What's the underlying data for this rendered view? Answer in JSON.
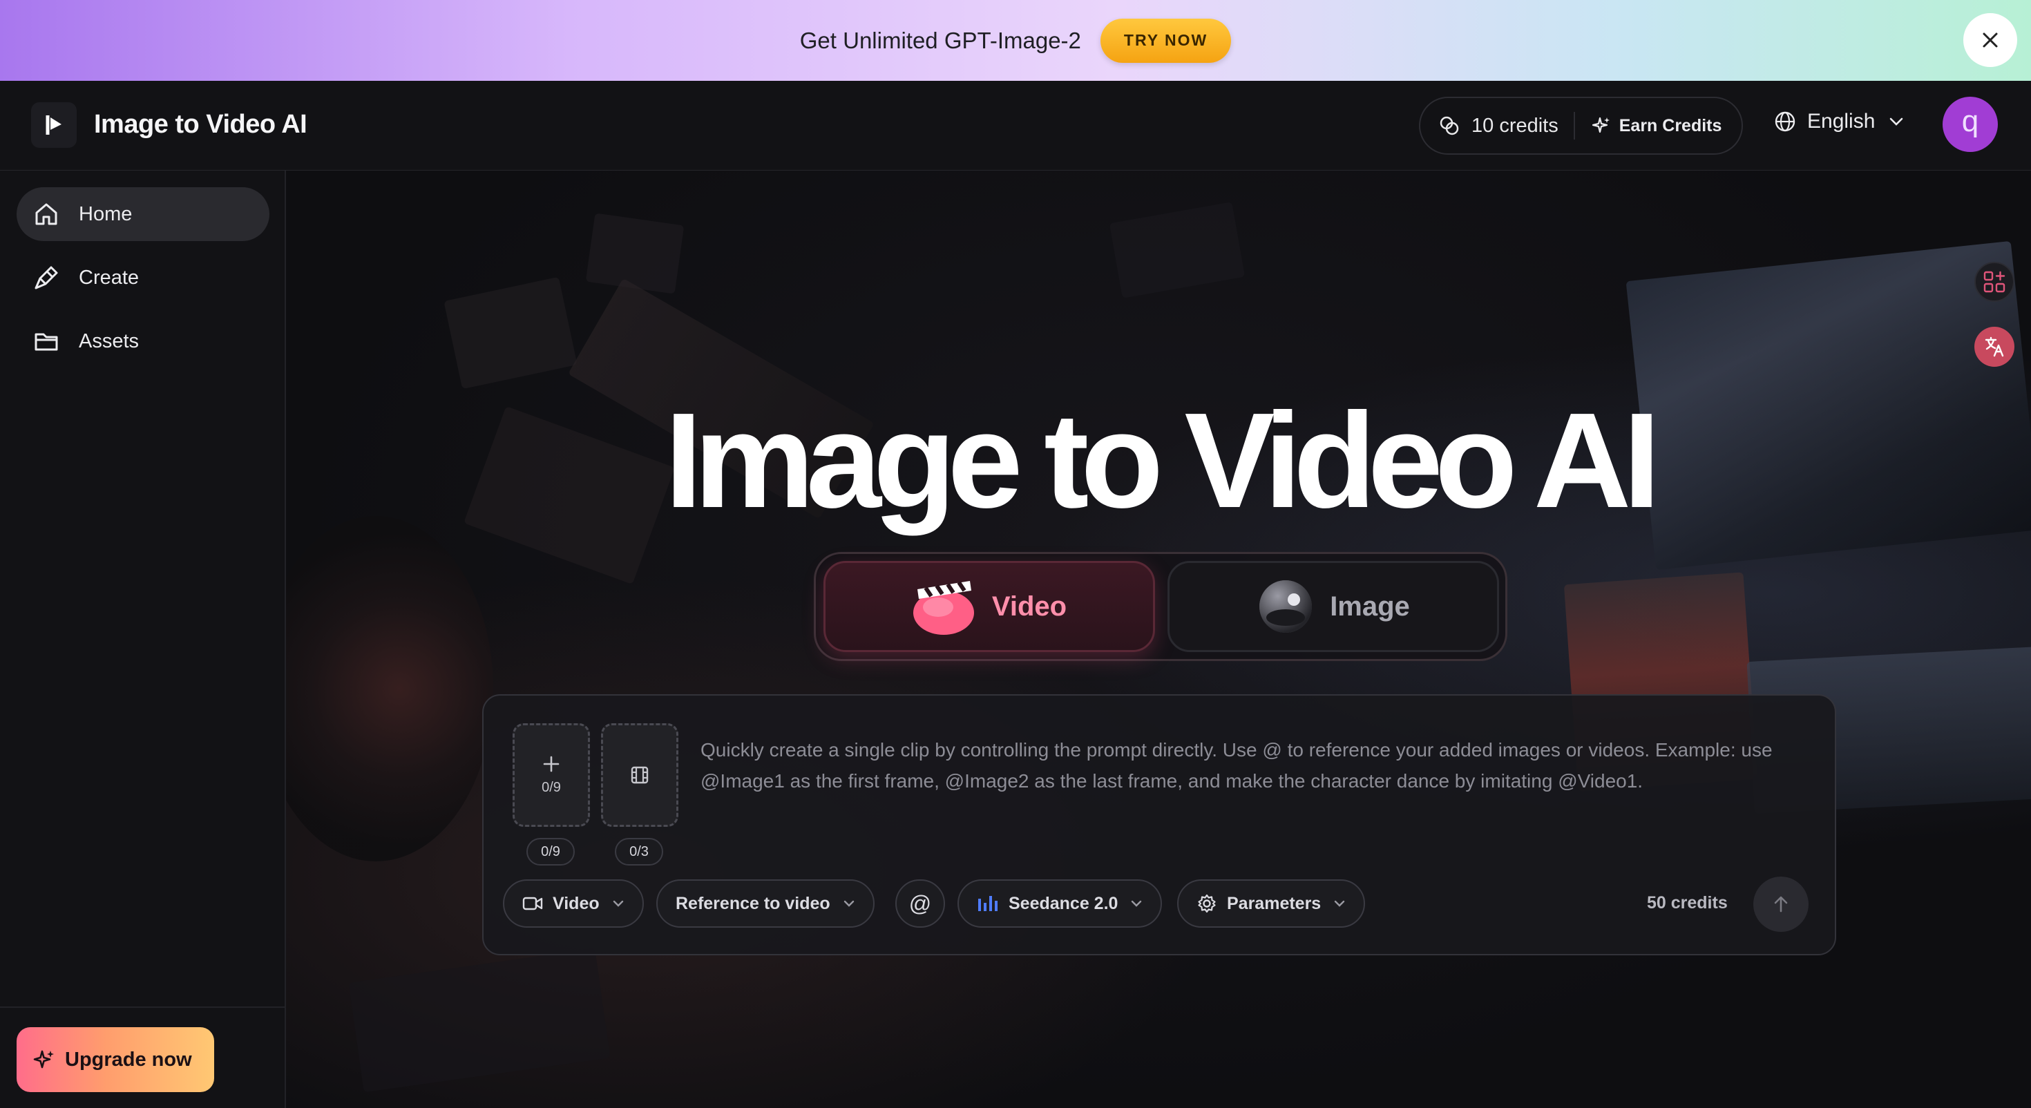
{
  "promo": {
    "text": "Get Unlimited GPT-Image-2",
    "button_label": "TRY NOW",
    "close_icon": "close-icon"
  },
  "header": {
    "app_title": "Image to Video AI",
    "credits_label": "10 credits",
    "earn_label": "Earn Credits",
    "language": "English",
    "avatar_initial": "q"
  },
  "sidebar": {
    "items": [
      {
        "label": "Home",
        "icon": "home-icon",
        "active": true
      },
      {
        "label": "Create",
        "icon": "brush-icon",
        "active": false
      },
      {
        "label": "Assets",
        "icon": "folder-icon",
        "active": false
      }
    ],
    "upgrade_label": "Upgrade now"
  },
  "hero": {
    "title": "Image to Video AI",
    "modes": [
      {
        "label": "Video",
        "selected": true
      },
      {
        "label": "Image",
        "selected": false
      }
    ]
  },
  "composer": {
    "image_slot_count": "0/9",
    "image_badge": "0/9",
    "video_badge": "0/3",
    "prompt_placeholder": "Quickly create a single clip by controlling the prompt directly. Use @ to reference your added images or videos. Example: use @Image1 as the first frame, @Image2 as the last frame, and make the character dance by imitating @Video1.",
    "type_label": "Video",
    "mode_label": "Reference to video",
    "at_label": "@",
    "model_label": "Seedance 2.0",
    "params_label": "Parameters",
    "cost_label": "50 credits"
  },
  "colors": {
    "accent_pink": "#ff8fab",
    "upgrade_start": "#ff6d8a",
    "upgrade_end": "#ffc873",
    "try_now": "#f5a312",
    "avatar": "#a13dd4"
  }
}
